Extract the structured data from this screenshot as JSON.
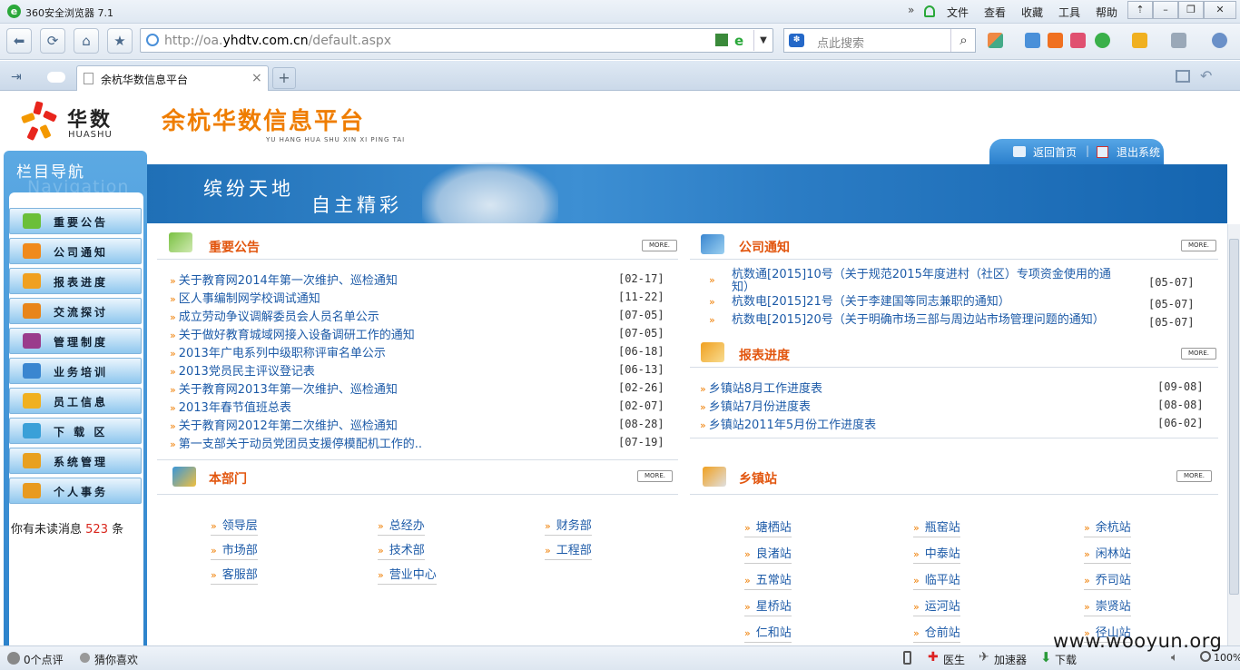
{
  "browser": {
    "title": "360安全浏览器 7.1",
    "menu": [
      "文件",
      "查看",
      "收藏",
      "工具",
      "帮助"
    ],
    "url_prefix": "http://oa.",
    "url_domain": "yhdtv.com.cn",
    "url_path": "/default.aspx",
    "search_placeholder": "点此搜索",
    "tab_title": "余杭华数信息平台",
    "tab_close": "×",
    "new_tab": "+"
  },
  "header": {
    "logo_cn": "华数",
    "logo_en": "HUASHU",
    "site_title": "余杭华数信息平台",
    "site_subtitle": "YU HANG HUA SHU XIN XI PING TAI",
    "home_link": "返回首页",
    "logout_link": "退出系统",
    "banner_line1": "缤纷天地",
    "banner_line2": "自主精彩"
  },
  "sidebar": {
    "title": "栏目导航",
    "title_en": "Navigation",
    "items": [
      {
        "label": "重要公告",
        "color": "#6bbf3a"
      },
      {
        "label": "公司通知",
        "color": "#f08a1c"
      },
      {
        "label": "报表进度",
        "color": "#f0a020"
      },
      {
        "label": "交流探讨",
        "color": "#e8851a"
      },
      {
        "label": "管理制度",
        "color": "#9a3c8c"
      },
      {
        "label": "业务培训",
        "color": "#3a86d0"
      },
      {
        "label": "员工信息",
        "color": "#f0b020"
      },
      {
        "label": "下 载 区",
        "color": "#3aa0d8"
      },
      {
        "label": "系统管理",
        "color": "#e8a020"
      },
      {
        "label": "个人事务",
        "color": "#e89a20"
      }
    ],
    "unread_prefix": "你有未读消息",
    "unread_count": "523",
    "unread_suffix": "条"
  },
  "sections": {
    "more_label": "MORE.",
    "announcements": {
      "title": "重要公告",
      "items": [
        {
          "text": "关于教育网2014年第一次维护、巡检通知",
          "date": "[02-17]"
        },
        {
          "text": "区人事编制网学校调试通知",
          "date": "[11-22]"
        },
        {
          "text": "成立劳动争议调解委员会人员名单公示",
          "date": "[07-05]"
        },
        {
          "text": "关于做好教育城域网接入设备调研工作的通知",
          "date": "[07-05]"
        },
        {
          "text": "2013年广电系列中级职称评审名单公示",
          "date": "[06-18]"
        },
        {
          "text": "2013党员民主评议登记表",
          "date": "[06-13]"
        },
        {
          "text": "关于教育网2013年第一次维护、巡检通知",
          "date": "[02-26]"
        },
        {
          "text": "2013年春节值班总表",
          "date": "[02-07]"
        },
        {
          "text": "关于教育网2012年第二次维护、巡检通知",
          "date": "[08-28]"
        },
        {
          "text": "第一支部关于动员党团员支援停模配机工作的..",
          "date": "[07-19]"
        }
      ]
    },
    "notices": {
      "title": "公司通知",
      "items": [
        {
          "text": "杭数通[2015]10号（关于规范2015年度进村（社区）专项资金使用的通",
          "text2": "知）",
          "date": "[05-07]"
        },
        {
          "text": "杭数电[2015]21号（关于李建国等同志兼职的通知）",
          "text2": "",
          "date": "[05-07]"
        },
        {
          "text": "杭数电[2015]20号（关于明确市场三部与周边站市场管理问题的通知）",
          "text2": "",
          "date": "[05-07]"
        }
      ]
    },
    "reports": {
      "title": "报表进度",
      "items": [
        {
          "text": "乡镇站8月工作进度表",
          "date": "[09-08]"
        },
        {
          "text": "乡镇站7月份进度表",
          "date": "[08-08]"
        },
        {
          "text": "乡镇站2011年5月份工作进度表",
          "date": "[06-02]"
        }
      ]
    },
    "department": {
      "title": "本部门",
      "items": [
        "领导层",
        "总经办",
        "财务部",
        "市场部",
        "技术部",
        "工程部",
        "客服部",
        "营业中心"
      ]
    },
    "stations": {
      "title": "乡镇站",
      "items": [
        "塘栖站",
        "瓶窑站",
        "余杭站",
        "良渚站",
        "中泰站",
        "闲林站",
        "五常站",
        "临平站",
        "乔司站",
        "星桥站",
        "运河站",
        "崇贤站",
        "仁和站",
        "仓前站",
        "径山站"
      ]
    }
  },
  "statusbar": {
    "left1": "0个点评",
    "left2": "猜你喜欢",
    "doctor": "医生",
    "accelerator": "加速器",
    "download": "下载",
    "zoom": "100%"
  },
  "watermark": "www.wooyun.org"
}
